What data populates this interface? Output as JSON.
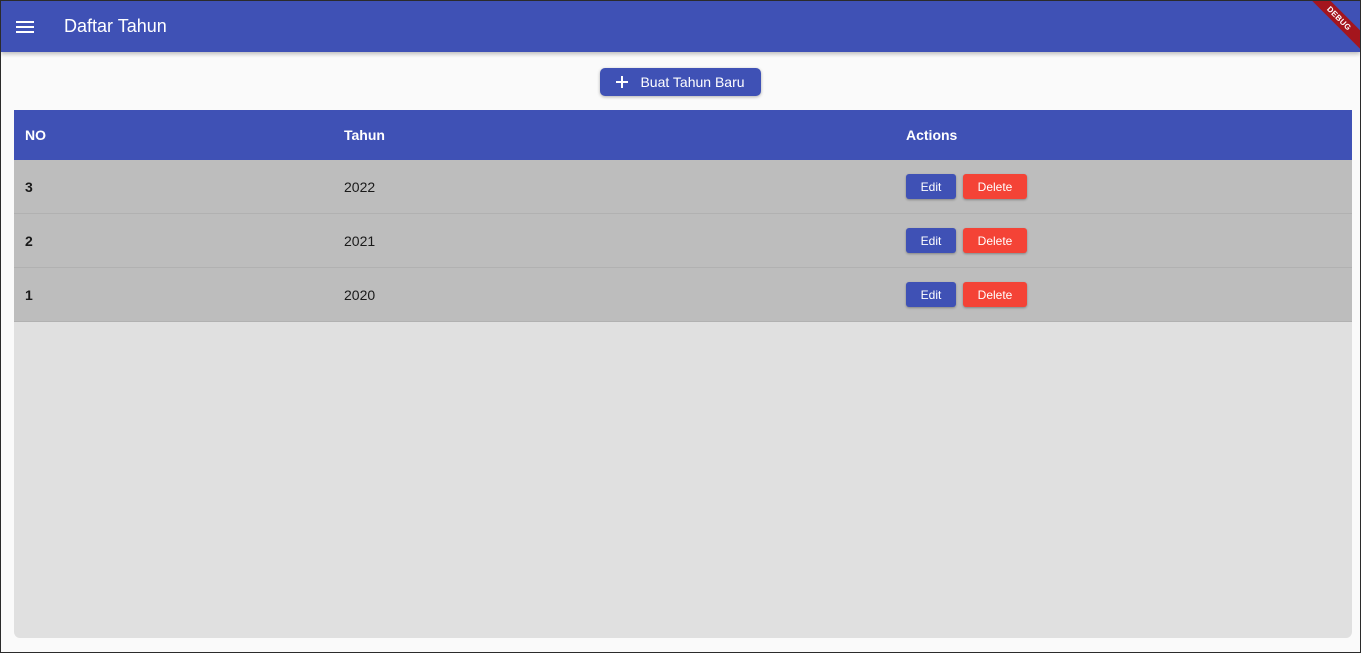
{
  "appbar": {
    "title": "Daftar Tahun",
    "menu_icon": "menu-icon",
    "debug_banner": "DEBUG"
  },
  "toolbar": {
    "new_button_label": "Buat Tahun Baru",
    "new_button_icon": "plus-icon"
  },
  "table": {
    "headers": {
      "no": "NO",
      "tahun": "Tahun",
      "actions": "Actions"
    },
    "rows": [
      {
        "no": "3",
        "tahun": "2022",
        "edit_label": "Edit",
        "delete_label": "Delete"
      },
      {
        "no": "2",
        "tahun": "2021",
        "edit_label": "Edit",
        "delete_label": "Delete"
      },
      {
        "no": "1",
        "tahun": "2020",
        "edit_label": "Edit",
        "delete_label": "Delete"
      }
    ]
  },
  "colors": {
    "primary": "#3f51b5",
    "danger": "#f44336",
    "row_background": "#bdbdbd",
    "table_background": "#e0e0e0",
    "debug_banner": "#a4151d"
  }
}
